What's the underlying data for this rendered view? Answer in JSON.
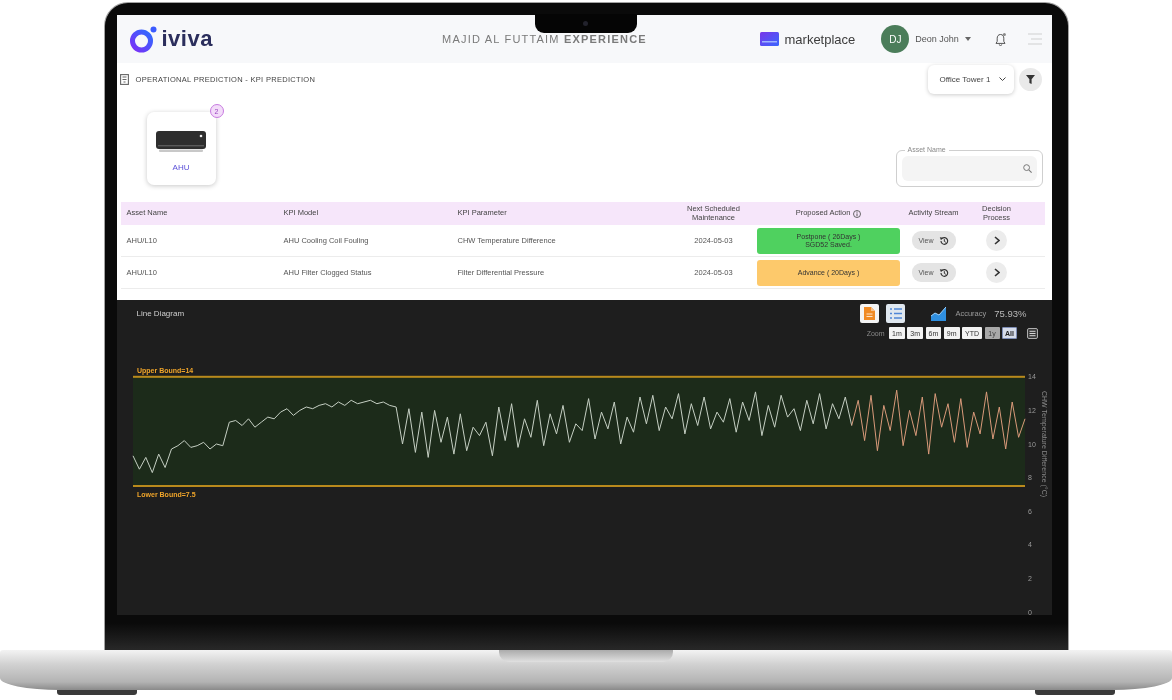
{
  "header": {
    "logo": "iviva",
    "title": "MAJID AL FUTTAIM **EXPERIENCE**",
    "marketplace": "marketplace",
    "user": {
      "initials": "DJ",
      "name": "Deon John"
    },
    "notifications": {
      "unread": true
    }
  },
  "breadcrumb": {
    "title": "OPERATIONAL PREDICTION - KPI PREDICTION",
    "site": "Office Tower 1"
  },
  "asset_types": [
    {
      "label": "AHU",
      "count": "2"
    }
  ],
  "asset_search": {
    "label": "Asset Name"
  },
  "table": {
    "columns": [
      {
        "label": "Asset Name",
        "info": false
      },
      {
        "label": "KPI Model",
        "info": false
      },
      {
        "label": "KPI Parameter",
        "info": false
      },
      {
        "label": "Next Scheduled Maintenance",
        "info": false
      },
      {
        "label": "Proposed Action",
        "info": true
      },
      {
        "label": "Activity Stream",
        "info": false
      },
      {
        "label": "Decision Process",
        "info": false
      }
    ],
    "rows": [
      {
        "asset_name": "AHU/L10",
        "kpi_model": "AHU Cooling Coil Fouling",
        "kpi_parameter": "CHW Temperature Difference",
        "next_maintenance": "2024-05-03",
        "action": {
          "label": "Postpone ( 26Days )",
          "note": "SGD52 Saved.",
          "color": "#4fd15f"
        },
        "activity": "View"
      },
      {
        "asset_name": "AHU/L10",
        "kpi_model": "AHU Filter Clogged Status",
        "kpi_parameter": "Filter Differential Pressure",
        "next_maintenance": "2024-05-03",
        "action": {
          "label": "Advance ( 20Days )",
          "color": "#fdc96b"
        },
        "activity": "View"
      }
    ]
  },
  "chart_panel": {
    "title": "Line Diagram",
    "accuracy_label": "Accuracy",
    "accuracy": "75.93%",
    "zoom_label": "Zoom",
    "zoom_buttons": [
      {
        "label": "1m",
        "selected": false,
        "disabled": false
      },
      {
        "label": "3m",
        "selected": false,
        "disabled": false
      },
      {
        "label": "6m",
        "selected": false,
        "disabled": false
      },
      {
        "label": "9m",
        "selected": false,
        "disabled": false
      },
      {
        "label": "YTD",
        "selected": false,
        "disabled": false
      },
      {
        "label": "1y",
        "selected": false,
        "disabled": true
      },
      {
        "label": "All",
        "selected": true,
        "disabled": false
      }
    ],
    "chart_data": {
      "type": "line",
      "ylabel": "CHW Temperature Difference (°C)",
      "ylim": [
        0,
        14
      ],
      "yticks": [
        0,
        2,
        4,
        6,
        8,
        10,
        12,
        14
      ],
      "series": [
        {
          "color": "#c5cfc3",
          "values": [
            9.3,
            8.5,
            9.2,
            8.3,
            9.4,
            8.6,
            9.7,
            9.9,
            10.2,
            9.8,
            9.9,
            10.1,
            9.7,
            10.0,
            9.9,
            11.3,
            11.4,
            11.1,
            11.5,
            11.0,
            11.3,
            11.6,
            11.5,
            11.9,
            12.1,
            11.7,
            12.0,
            12.2,
            12.1,
            12.3,
            12.4,
            12.2,
            12.5,
            12.3,
            12.6,
            12.4,
            12.5,
            12.6,
            12.4,
            12.5,
            12.3,
            12.2,
            10.0,
            12.1,
            9.5,
            11.9,
            9.2,
            12.0,
            10.1,
            11.6,
            9.4,
            11.8,
            9.6,
            11.0,
            10.5,
            11.3,
            9.3,
            12.2,
            10.2,
            12.4,
            9.8,
            11.5,
            10.4,
            12.6,
            9.9,
            11.8,
            10.6,
            12.3,
            10.1,
            11.2,
            10.8,
            12.7,
            10.3,
            11.9,
            10.9,
            12.5,
            10.0,
            11.6,
            10.7,
            12.8,
            11.2,
            12.9,
            10.8,
            12.2,
            11.5,
            13.0,
            10.6,
            12.4,
            11.1,
            12.8,
            10.9,
            11.9,
            11.3,
            12.7,
            10.7,
            12.5,
            11.4,
            13.1,
            10.5,
            12.3,
            11.0,
            12.9,
            11.6,
            12.1,
            10.8,
            12.6,
            11.2,
            13.0,
            10.9,
            12.4,
            11.5,
            12.8,
            11.1,
            null,
            null,
            null,
            null,
            null,
            null,
            null,
            null,
            null,
            null,
            null,
            null,
            null,
            null,
            null,
            null,
            null,
            null,
            null,
            null,
            null,
            null,
            null,
            null,
            null,
            null,
            null
          ]
        },
        {
          "color": "#d99a7a",
          "values": [
            null,
            null,
            null,
            null,
            null,
            null,
            null,
            null,
            null,
            null,
            null,
            null,
            null,
            null,
            null,
            null,
            null,
            null,
            null,
            null,
            null,
            null,
            null,
            null,
            null,
            null,
            null,
            null,
            null,
            null,
            null,
            null,
            null,
            null,
            null,
            null,
            null,
            null,
            null,
            null,
            null,
            null,
            null,
            null,
            null,
            null,
            null,
            null,
            null,
            null,
            null,
            null,
            null,
            null,
            null,
            null,
            null,
            null,
            null,
            null,
            null,
            null,
            null,
            null,
            null,
            null,
            null,
            null,
            null,
            null,
            null,
            null,
            null,
            null,
            null,
            null,
            null,
            null,
            null,
            null,
            null,
            null,
            null,
            null,
            null,
            null,
            null,
            null,
            null,
            null,
            null,
            null,
            null,
            null,
            null,
            null,
            null,
            null,
            null,
            null,
            null,
            null,
            null,
            null,
            null,
            null,
            null,
            null,
            null,
            null,
            null,
            null,
            11.1,
            12.6,
            10.2,
            12.9,
            9.6,
            12.3,
            10.8,
            13.2,
            9.9,
            12.0,
            10.5,
            12.8,
            9.4,
            13.0,
            11.0,
            12.4,
            10.1,
            12.7,
            9.8,
            11.9,
            10.6,
            13.1,
            10.3,
            12.2,
            9.7,
            12.5,
            10.4,
            11.5
          ]
        }
      ],
      "ref_lines": [
        {
          "axis": "y",
          "value": 14,
          "label": "Upper Bound=14"
        },
        {
          "axis": "y",
          "value": 7.5,
          "label": "Lower Bound=7.5"
        }
      ],
      "bands": [
        {
          "axis": "y",
          "from": 7.5,
          "to": 14
        }
      ]
    }
  }
}
